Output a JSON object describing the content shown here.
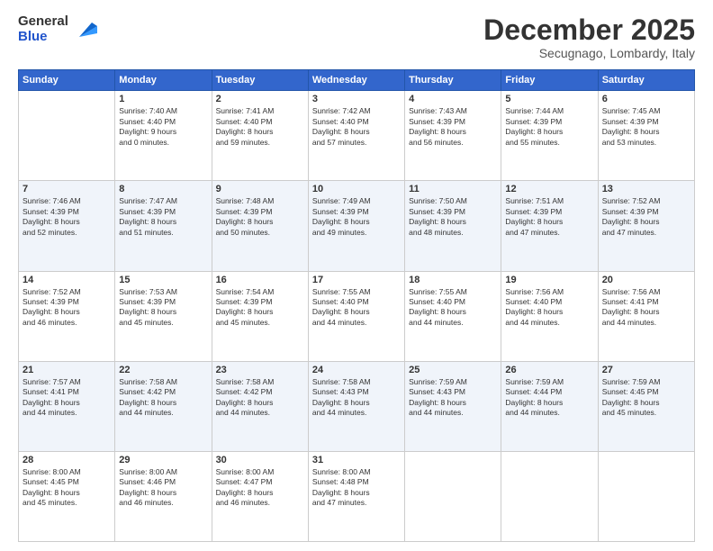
{
  "header": {
    "logo_line1": "General",
    "logo_line2": "Blue",
    "month": "December 2025",
    "location": "Secugnago, Lombardy, Italy"
  },
  "days_of_week": [
    "Sunday",
    "Monday",
    "Tuesday",
    "Wednesday",
    "Thursday",
    "Friday",
    "Saturday"
  ],
  "weeks": [
    [
      {
        "day": "",
        "info": ""
      },
      {
        "day": "1",
        "info": "Sunrise: 7:40 AM\nSunset: 4:40 PM\nDaylight: 9 hours\nand 0 minutes."
      },
      {
        "day": "2",
        "info": "Sunrise: 7:41 AM\nSunset: 4:40 PM\nDaylight: 8 hours\nand 59 minutes."
      },
      {
        "day": "3",
        "info": "Sunrise: 7:42 AM\nSunset: 4:40 PM\nDaylight: 8 hours\nand 57 minutes."
      },
      {
        "day": "4",
        "info": "Sunrise: 7:43 AM\nSunset: 4:39 PM\nDaylight: 8 hours\nand 56 minutes."
      },
      {
        "day": "5",
        "info": "Sunrise: 7:44 AM\nSunset: 4:39 PM\nDaylight: 8 hours\nand 55 minutes."
      },
      {
        "day": "6",
        "info": "Sunrise: 7:45 AM\nSunset: 4:39 PM\nDaylight: 8 hours\nand 53 minutes."
      }
    ],
    [
      {
        "day": "7",
        "info": "Sunrise: 7:46 AM\nSunset: 4:39 PM\nDaylight: 8 hours\nand 52 minutes."
      },
      {
        "day": "8",
        "info": "Sunrise: 7:47 AM\nSunset: 4:39 PM\nDaylight: 8 hours\nand 51 minutes."
      },
      {
        "day": "9",
        "info": "Sunrise: 7:48 AM\nSunset: 4:39 PM\nDaylight: 8 hours\nand 50 minutes."
      },
      {
        "day": "10",
        "info": "Sunrise: 7:49 AM\nSunset: 4:39 PM\nDaylight: 8 hours\nand 49 minutes."
      },
      {
        "day": "11",
        "info": "Sunrise: 7:50 AM\nSunset: 4:39 PM\nDaylight: 8 hours\nand 48 minutes."
      },
      {
        "day": "12",
        "info": "Sunrise: 7:51 AM\nSunset: 4:39 PM\nDaylight: 8 hours\nand 47 minutes."
      },
      {
        "day": "13",
        "info": "Sunrise: 7:52 AM\nSunset: 4:39 PM\nDaylight: 8 hours\nand 47 minutes."
      }
    ],
    [
      {
        "day": "14",
        "info": "Sunrise: 7:52 AM\nSunset: 4:39 PM\nDaylight: 8 hours\nand 46 minutes."
      },
      {
        "day": "15",
        "info": "Sunrise: 7:53 AM\nSunset: 4:39 PM\nDaylight: 8 hours\nand 45 minutes."
      },
      {
        "day": "16",
        "info": "Sunrise: 7:54 AM\nSunset: 4:39 PM\nDaylight: 8 hours\nand 45 minutes."
      },
      {
        "day": "17",
        "info": "Sunrise: 7:55 AM\nSunset: 4:40 PM\nDaylight: 8 hours\nand 44 minutes."
      },
      {
        "day": "18",
        "info": "Sunrise: 7:55 AM\nSunset: 4:40 PM\nDaylight: 8 hours\nand 44 minutes."
      },
      {
        "day": "19",
        "info": "Sunrise: 7:56 AM\nSunset: 4:40 PM\nDaylight: 8 hours\nand 44 minutes."
      },
      {
        "day": "20",
        "info": "Sunrise: 7:56 AM\nSunset: 4:41 PM\nDaylight: 8 hours\nand 44 minutes."
      }
    ],
    [
      {
        "day": "21",
        "info": "Sunrise: 7:57 AM\nSunset: 4:41 PM\nDaylight: 8 hours\nand 44 minutes."
      },
      {
        "day": "22",
        "info": "Sunrise: 7:58 AM\nSunset: 4:42 PM\nDaylight: 8 hours\nand 44 minutes."
      },
      {
        "day": "23",
        "info": "Sunrise: 7:58 AM\nSunset: 4:42 PM\nDaylight: 8 hours\nand 44 minutes."
      },
      {
        "day": "24",
        "info": "Sunrise: 7:58 AM\nSunset: 4:43 PM\nDaylight: 8 hours\nand 44 minutes."
      },
      {
        "day": "25",
        "info": "Sunrise: 7:59 AM\nSunset: 4:43 PM\nDaylight: 8 hours\nand 44 minutes."
      },
      {
        "day": "26",
        "info": "Sunrise: 7:59 AM\nSunset: 4:44 PM\nDaylight: 8 hours\nand 44 minutes."
      },
      {
        "day": "27",
        "info": "Sunrise: 7:59 AM\nSunset: 4:45 PM\nDaylight: 8 hours\nand 45 minutes."
      }
    ],
    [
      {
        "day": "28",
        "info": "Sunrise: 8:00 AM\nSunset: 4:45 PM\nDaylight: 8 hours\nand 45 minutes."
      },
      {
        "day": "29",
        "info": "Sunrise: 8:00 AM\nSunset: 4:46 PM\nDaylight: 8 hours\nand 46 minutes."
      },
      {
        "day": "30",
        "info": "Sunrise: 8:00 AM\nSunset: 4:47 PM\nDaylight: 8 hours\nand 46 minutes."
      },
      {
        "day": "31",
        "info": "Sunrise: 8:00 AM\nSunset: 4:48 PM\nDaylight: 8 hours\nand 47 minutes."
      },
      {
        "day": "",
        "info": ""
      },
      {
        "day": "",
        "info": ""
      },
      {
        "day": "",
        "info": ""
      }
    ]
  ]
}
